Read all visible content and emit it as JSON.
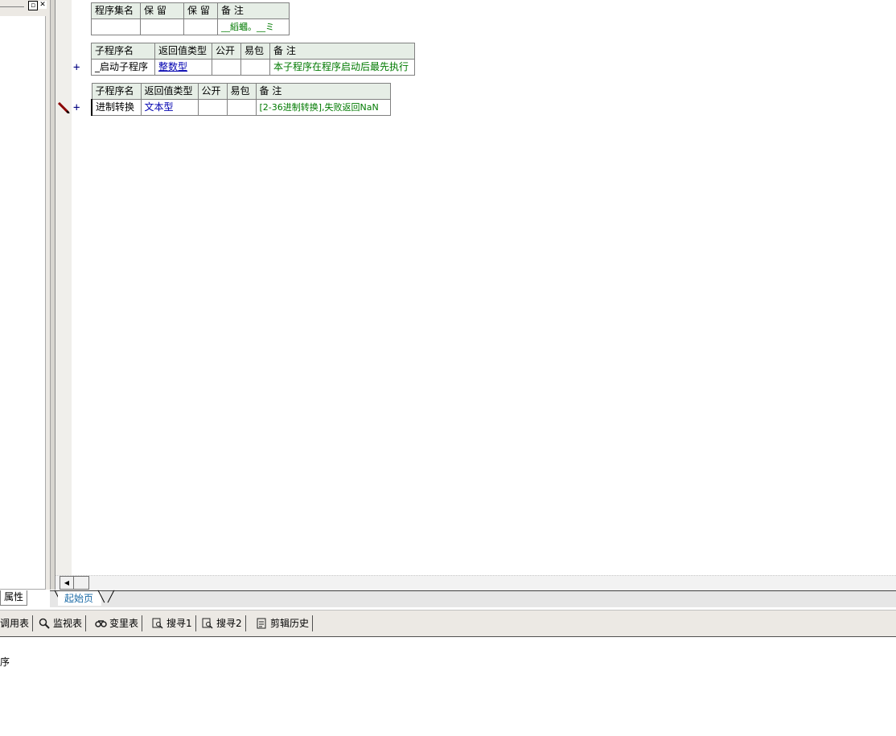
{
  "left_panel": {
    "restore_glyph": "▫",
    "close_glyph": "✕",
    "tab_label": "属性"
  },
  "table1": {
    "headers": [
      "程序集名",
      "保 留",
      "保 留",
      "备 注"
    ],
    "row": [
      "",
      "",
      "",
      "__縚蟈。__ミ"
    ]
  },
  "table2": {
    "headers": [
      "子程序名",
      "返回值类型",
      "公开",
      "易包",
      "备 注"
    ],
    "row": [
      "_启动子程序",
      "整数型",
      "",
      "",
      "本子程序在程序启动后最先执行"
    ]
  },
  "table3": {
    "headers": [
      "子程序名",
      "返回值类型",
      "公开",
      "易包",
      "备 注"
    ],
    "row": [
      "进制转换",
      "文本型",
      "",
      "",
      "[2-36进制转换],失败返回NaN"
    ]
  },
  "gutter": {
    "plus": "+"
  },
  "tabs": {
    "start_page": "起始页"
  },
  "toolbar": {
    "items": [
      {
        "label": "调用表",
        "icon": "call-table-icon"
      },
      {
        "label": "监视表",
        "icon": "magnifier-icon"
      },
      {
        "label": "变里表",
        "icon": "variable-table-icon"
      },
      {
        "label": "搜寻1",
        "icon": "search1-icon"
      },
      {
        "label": "搜寻2",
        "icon": "search2-icon"
      },
      {
        "label": "剪辑历史",
        "icon": "clipboard-history-icon"
      }
    ]
  },
  "output": {
    "text": "序"
  }
}
